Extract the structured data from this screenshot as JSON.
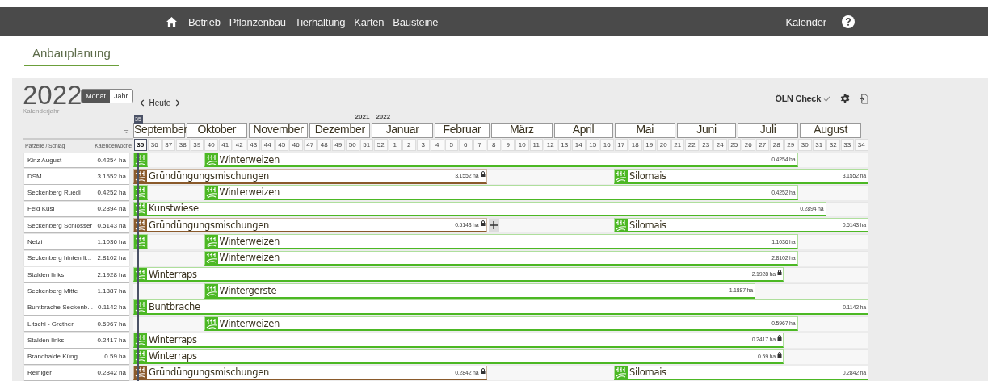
{
  "nav": {
    "items": [
      {
        "label": "Betrieb"
      },
      {
        "label": "Pflanzenbau"
      },
      {
        "label": "Tierhaltung"
      },
      {
        "label": "Karten"
      },
      {
        "label": "Bausteine"
      }
    ],
    "right_label": "Kalender"
  },
  "tabs": [
    {
      "label": "Anbauplanung",
      "selected": true
    }
  ],
  "toolbar": {
    "year": "2022",
    "year_caption": "Kalenderjahr",
    "view_modes": [
      {
        "label": "Monat",
        "selected": true
      },
      {
        "label": "Jahr",
        "selected": false
      }
    ],
    "today_label": "Heute",
    "check_label": "ÖLN Check",
    "check_ok": true
  },
  "calendar": {
    "years": [
      "2021",
      "2022"
    ],
    "months": [
      "September",
      "Oktober",
      "November",
      "Dezember",
      "Januar",
      "Februar",
      "März",
      "April",
      "Mai",
      "Juni",
      "Juli",
      "August"
    ],
    "current_badge": "35",
    "field_header": "Parzelle / Schlag",
    "week_header": "Kalenderwoche",
    "weeks": [
      {
        "label": "35",
        "current": true
      },
      {
        "label": "36",
        "current": false
      },
      {
        "label": "37",
        "current": false
      },
      {
        "label": "38",
        "current": false
      },
      {
        "label": "39",
        "current": false
      },
      {
        "label": "40",
        "current": false
      },
      {
        "label": "41",
        "current": false
      },
      {
        "label": "42",
        "current": false
      },
      {
        "label": "43",
        "current": false
      },
      {
        "label": "44",
        "current": false
      },
      {
        "label": "45",
        "current": false
      },
      {
        "label": "46",
        "current": false
      },
      {
        "label": "47",
        "current": false
      },
      {
        "label": "48",
        "current": false
      },
      {
        "label": "49",
        "current": false
      },
      {
        "label": "50",
        "current": false
      },
      {
        "label": "51",
        "current": false
      },
      {
        "label": "52",
        "current": false
      },
      {
        "label": "1",
        "current": false
      },
      {
        "label": "2",
        "current": false
      },
      {
        "label": "3",
        "current": false
      },
      {
        "label": "4",
        "current": false
      },
      {
        "label": "5",
        "current": false
      },
      {
        "label": "6",
        "current": false
      },
      {
        "label": "7",
        "current": false
      },
      {
        "label": "8",
        "current": false
      },
      {
        "label": "9",
        "current": false
      },
      {
        "label": "10",
        "current": false
      },
      {
        "label": "11",
        "current": false
      },
      {
        "label": "12",
        "current": false
      },
      {
        "label": "13",
        "current": false
      },
      {
        "label": "14",
        "current": false
      },
      {
        "label": "15",
        "current": false
      },
      {
        "label": "16",
        "current": false
      },
      {
        "label": "17",
        "current": false
      },
      {
        "label": "18",
        "current": false
      },
      {
        "label": "19",
        "current": false
      },
      {
        "label": "20",
        "current": false
      },
      {
        "label": "21",
        "current": false
      },
      {
        "label": "22",
        "current": false
      },
      {
        "label": "23",
        "current": false
      },
      {
        "label": "24",
        "current": false
      },
      {
        "label": "25",
        "current": false
      },
      {
        "label": "26",
        "current": false
      },
      {
        "label": "27",
        "current": false
      },
      {
        "label": "28",
        "current": false
      },
      {
        "label": "29",
        "current": false
      },
      {
        "label": "30",
        "current": false
      },
      {
        "label": "31",
        "current": false
      },
      {
        "label": "32",
        "current": false
      },
      {
        "label": "33",
        "current": false
      },
      {
        "label": "34",
        "current": false
      }
    ]
  },
  "rows": [
    {
      "name": "Kinz August",
      "area": "0.4254 ha",
      "bars": [
        {
          "color": "#4cb824"
        },
        {
          "label": "Winterweizen",
          "area": "0.4254 ha",
          "locked": false,
          "color": "#4cb824"
        }
      ]
    },
    {
      "name": "DSM",
      "area": "3.1552 ha",
      "bars": [
        {
          "label": "Gründüngungsmischungen",
          "area": "3.1552 ha",
          "locked": true,
          "color": "#8a5a2b"
        },
        {
          "label": "Silomais",
          "area": "3.1552 ha",
          "locked": false,
          "color": "#4cb824"
        }
      ]
    },
    {
      "name": "Seckenberg Ruedi",
      "area": "0.4252 ha",
      "bars": [
        {
          "color": "#4cb824"
        },
        {
          "label": "Winterweizen",
          "area": "0.4252 ha",
          "locked": false,
          "color": "#4cb824"
        }
      ]
    },
    {
      "name": "Feld Kusi",
      "area": "0.2894 ha",
      "bars": [
        {
          "label": "Kunstwiese",
          "area": "0.2894 ha",
          "locked": false,
          "color": "#4cb824"
        }
      ]
    },
    {
      "name": "Seckenberg Schlosser",
      "area": "0.5143 ha",
      "bars": [
        {
          "label": "Gründüngungsmischungen",
          "area": "0.5143 ha",
          "locked": true,
          "add_button": true,
          "color": "#8a5a2b"
        },
        {
          "label": "Silomais",
          "area": "0.5143 ha",
          "locked": false,
          "color": "#4cb824"
        }
      ]
    },
    {
      "name": "Netzi",
      "area": "1.1036 ha",
      "bars": [
        {
          "color": "#4cb824"
        },
        {
          "label": "Winterweizen",
          "area": "1.1036 ha",
          "locked": false,
          "color": "#4cb824"
        }
      ]
    },
    {
      "name": "Seckenberg hinten li...",
      "area": "2.8102 ha",
      "bars": [
        {
          "label": "Winterweizen",
          "area": "2.8102 ha",
          "locked": false,
          "color": "#4cb824"
        }
      ]
    },
    {
      "name": "Stalden links",
      "area": "2.1928 ha",
      "bars": [
        {
          "label": "Winterraps",
          "area": "2.1928 ha",
          "locked": true,
          "color": "#4cb824"
        }
      ]
    },
    {
      "name": "Seckenberg Mitte",
      "area": "1.1887 ha",
      "bars": [
        {
          "label": "Wintergerste",
          "area": "1.1887 ha",
          "locked": false,
          "color": "#4cb824"
        }
      ]
    },
    {
      "name": "Buntbrache Seckenb...",
      "area": "0.1142 ha",
      "bars": [
        {
          "label": "Buntbrache",
          "area": "0.1142 ha",
          "locked": false,
          "color": "#4cb824"
        }
      ]
    },
    {
      "name": "Litschi - Grether",
      "area": "0.5967 ha",
      "bars": [
        {
          "label": "Winterweizen",
          "area": "0.5967 ha",
          "locked": false,
          "color": "#4cb824"
        }
      ]
    },
    {
      "name": "Stalden links",
      "area": "0.2417 ha",
      "bars": [
        {
          "label": "Winterraps",
          "area": "0.2417 ha",
          "locked": true,
          "color": "#4cb824"
        }
      ]
    },
    {
      "name": "Brandhalde Küng",
      "area": "0.59 ha",
      "bars": [
        {
          "label": "Winterraps",
          "area": "0.59 ha",
          "locked": true,
          "color": "#4cb824"
        }
      ]
    },
    {
      "name": "Reiniger",
      "area": "0.2842 ha",
      "bars": [
        {
          "label": "Gründüngungsmischungen",
          "area": "0.2842 ha",
          "locked": true,
          "color": "#8a5a2b"
        },
        {
          "label": "Silomais",
          "area": "0.2842 ha",
          "locked": false,
          "color": "#4cb824"
        }
      ]
    }
  ]
}
